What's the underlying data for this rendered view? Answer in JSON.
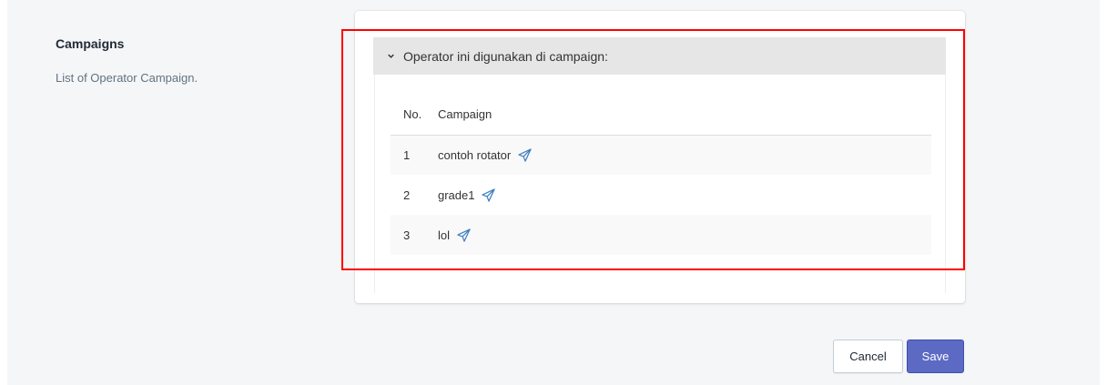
{
  "section": {
    "title": "Campaigns",
    "description": "List of Operator Campaign."
  },
  "panel": {
    "header": "Operator ini digunakan di campaign:"
  },
  "table": {
    "headers": [
      "No.",
      "Campaign"
    ],
    "rows": [
      {
        "no": "1",
        "campaign": "contoh rotator"
      },
      {
        "no": "2",
        "campaign": "grade1"
      },
      {
        "no": "3",
        "campaign": "lol"
      }
    ]
  },
  "actions": {
    "cancel_label": "Cancel",
    "save_label": "Save"
  },
  "icons": {
    "campaign_link": "send-icon",
    "panel_toggle": "chevron-down-icon"
  },
  "colors": {
    "primary": "#5c6ac4",
    "icon_blue": "#3f7fc1",
    "highlight": "#ff0000",
    "panel_header_bg": "#e6e6e6"
  }
}
